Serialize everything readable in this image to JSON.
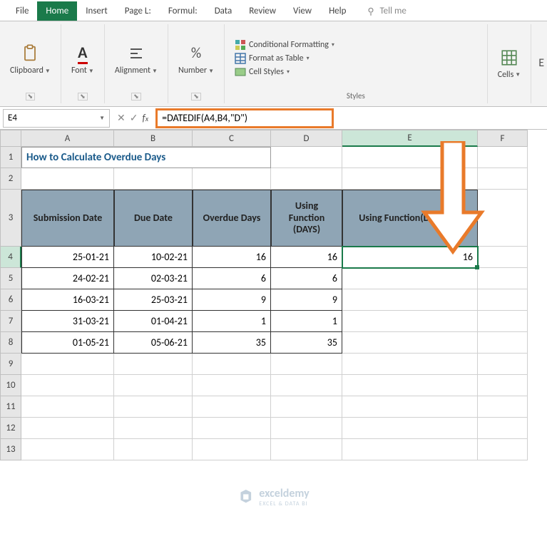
{
  "tabs": {
    "file": "File",
    "home": "Home",
    "insert": "Insert",
    "pagelayout": "Page L:",
    "formulas": "Formul:",
    "data": "Data",
    "review": "Review",
    "view": "View",
    "help": "Help",
    "tellme": "Tell me"
  },
  "ribbon": {
    "clipboard": "Clipboard",
    "font": "Font",
    "alignment": "Alignment",
    "number": "Number",
    "styles": "Styles",
    "cells": "Cells",
    "cond_format": "Conditional Formatting",
    "format_table": "Format as Table",
    "cell_styles": "Cell Styles"
  },
  "formula": {
    "namebox": "E4",
    "value": "=DATEDIF(A4,B4,\"D\")"
  },
  "columns": [
    "A",
    "B",
    "C",
    "D",
    "E",
    "F"
  ],
  "rows_labels": [
    "1",
    "2",
    "3",
    "4",
    "5",
    "6",
    "7",
    "8",
    "9",
    "10",
    "11",
    "12",
    "13"
  ],
  "sheet": {
    "title": "How to Calculate Overdue Days",
    "headers": {
      "A": "Submission Date",
      "B": "Due Date",
      "C": "Overdue Days",
      "D": "Using Function (DAYS)",
      "E": "Using Function(DATEDIF)"
    },
    "data": [
      {
        "A": "25-01-21",
        "B": "10-02-21",
        "C": "16",
        "D": "16",
        "E": "16"
      },
      {
        "A": "24-02-21",
        "B": "02-03-21",
        "C": "6",
        "D": "6",
        "E": ""
      },
      {
        "A": "16-03-21",
        "B": "25-03-21",
        "C": "9",
        "D": "9",
        "E": ""
      },
      {
        "A": "31-03-21",
        "B": "01-04-21",
        "C": "1",
        "D": "1",
        "E": ""
      },
      {
        "A": "01-05-21",
        "B": "05-06-21",
        "C": "35",
        "D": "35",
        "E": ""
      }
    ]
  },
  "selected_cell": "E4",
  "watermark": {
    "brand": "exceldemy",
    "tagline": "EXCEL & DATA BI"
  }
}
